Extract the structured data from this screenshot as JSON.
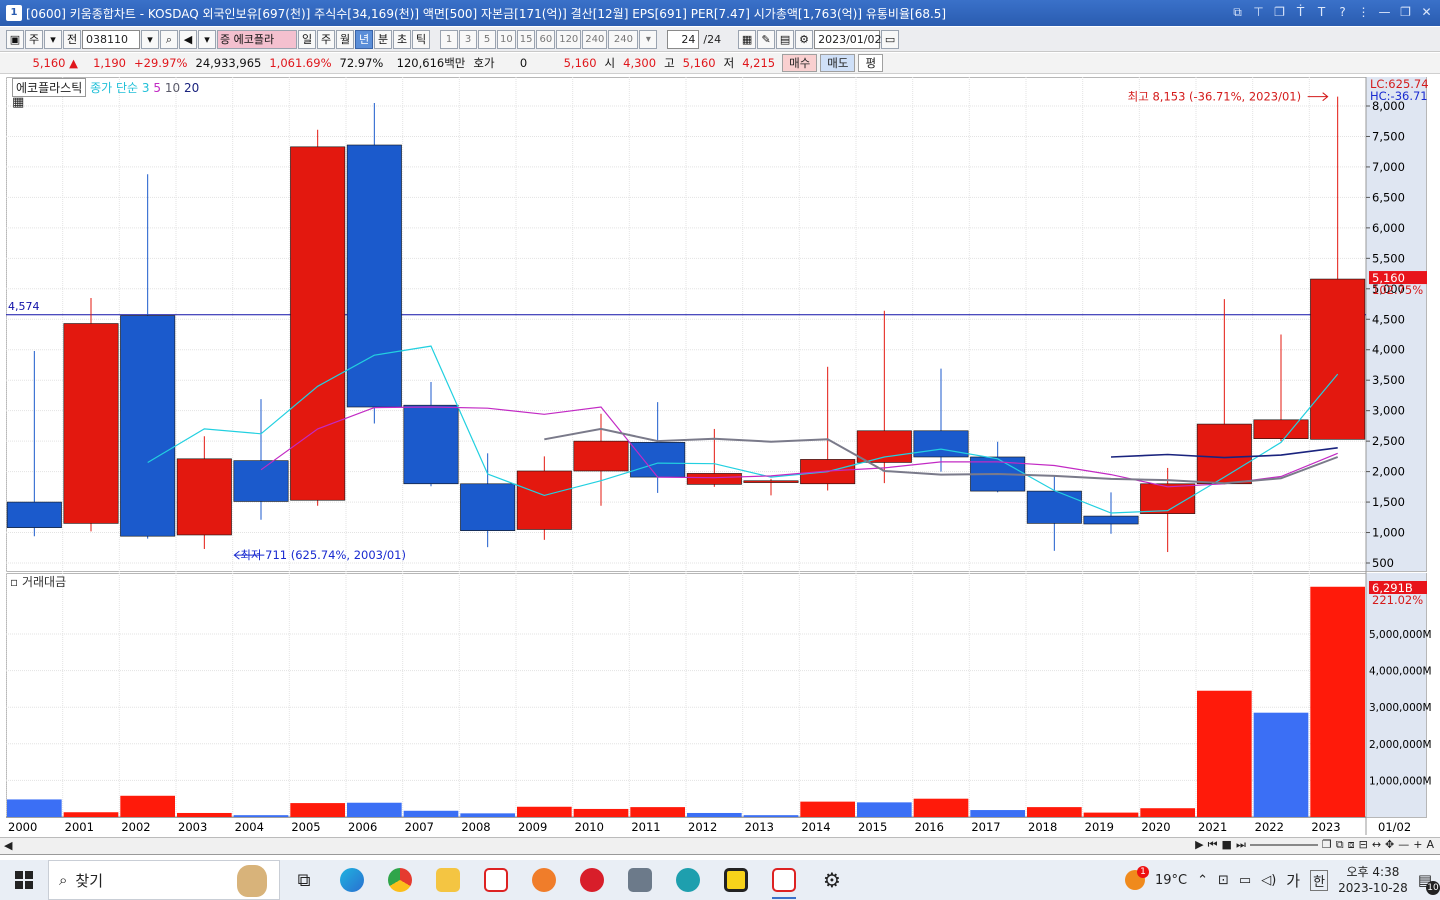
{
  "window": {
    "number": "1",
    "title": "[0600] 키움종합차트 - KOSDAQ 외국인보유[697(천)] 주식수[34,169(천)] 액면[500] 자본금[171(억)] 결산[12월] EPS[691] PER[7.47] 시가총액[1,763(억)] 유통비율[68.5]"
  },
  "toolbar": {
    "mode_a": "주",
    "mode_b": "전",
    "code": "038110",
    "stock_name": "에코플라",
    "periods": [
      "일",
      "주",
      "월",
      "년",
      "분",
      "초",
      "틱"
    ],
    "selected_period": "년",
    "intervals": [
      "1",
      "3",
      "5",
      "10",
      "15",
      "60",
      "120",
      "240",
      "240"
    ],
    "count": "24",
    "count_total": "/24",
    "date": "2023/01/02"
  },
  "quote": {
    "price": "5,160",
    "change": "1,190",
    "change_pct": "+29.97%",
    "volume": "24,933,965",
    "volume_pct": "1,061.69%",
    "turnover": "72.97%",
    "amount": "120,616백만",
    "hoga_label": "호가",
    "hoga_value": "0",
    "current": "5,160",
    "open_label": "시",
    "open": "4,300",
    "high_label": "고",
    "high": "5,160",
    "low_label": "저",
    "low": "4,215",
    "buy": "매수",
    "sell": "매도",
    "even": "평"
  },
  "legend": {
    "name": "에코플라스틱",
    "ma_label": "종가 단순",
    "ma3": "3",
    "ma5": "5",
    "ma10": "10",
    "ma20": "20",
    "volume_panel": "거래대금"
  },
  "annotations": {
    "high": "최고 8,153 (-36.71%, 2023/01)",
    "low": "최저 711 (625.74%, 2003/01)",
    "hline": "4,574",
    "lc": "LC:625.74",
    "hc": "HC:-36.71",
    "price_tag": "5,160",
    "price_tag_pct": "102.75%",
    "vol_tag": "6,291B",
    "vol_tag_pct": "221.02%",
    "last_date": "01/02"
  },
  "colors": {
    "up": "#e3180f",
    "down": "#1b5acc",
    "ma3": "#22d0e0",
    "ma5": "#c22ac4",
    "ma10": "#7a7a8a",
    "ma20": "#1a237e",
    "hline": "#1010a8"
  },
  "chart_data": {
    "type": "candlestick",
    "x": [
      "2000",
      "2001",
      "2002",
      "2003",
      "2004",
      "2005",
      "2006",
      "2007",
      "2008",
      "2009",
      "2010",
      "2011",
      "2012",
      "2013",
      "2014",
      "2015",
      "2016",
      "2017",
      "2018",
      "2019",
      "2020",
      "2021",
      "2022",
      "2023"
    ],
    "ohlc": [
      [
        1500,
        3980,
        940,
        1080
      ],
      [
        1150,
        4850,
        1020,
        4430
      ],
      [
        4560,
        6880,
        900,
        940
      ],
      [
        960,
        2580,
        730,
        2210
      ],
      [
        2180,
        3190,
        1210,
        1510
      ],
      [
        1530,
        7610,
        1440,
        7330
      ],
      [
        7360,
        8050,
        2790,
        3060
      ],
      [
        3090,
        3470,
        1760,
        1800
      ],
      [
        1800,
        2300,
        760,
        1030
      ],
      [
        1050,
        2250,
        880,
        2010
      ],
      [
        2010,
        2950,
        1440,
        2500
      ],
      [
        2480,
        3140,
        1650,
        1910
      ],
      [
        1790,
        2700,
        1750,
        1970
      ],
      [
        1820,
        1880,
        1610,
        1850
      ],
      [
        1800,
        3720,
        1690,
        2200
      ],
      [
        2150,
        4640,
        1810,
        2670
      ],
      [
        2670,
        3690,
        2000,
        2240
      ],
      [
        2240,
        2490,
        1660,
        1680
      ],
      [
        1680,
        1920,
        700,
        1150
      ],
      [
        1270,
        1660,
        980,
        1140
      ],
      [
        1310,
        2060,
        680,
        1800
      ],
      [
        1800,
        4830,
        1790,
        2780
      ],
      [
        2540,
        4250,
        2500,
        2850
      ],
      [
        2530,
        8153,
        4215,
        5160
      ]
    ],
    "ma3": [
      null,
      null,
      2150,
      2700,
      2620,
      3400,
      3910,
      4060,
      1960,
      1610,
      1850,
      2140,
      2130,
      1910,
      2000,
      2240,
      2370,
      2210,
      1690,
      1320,
      1360,
      1910,
      2480,
      3600
    ],
    "ma5": [
      null,
      null,
      null,
      null,
      2030,
      2700,
      3050,
      3060,
      3040,
      2940,
      3060,
      1910,
      1900,
      1930,
      2010,
      2060,
      2160,
      2160,
      2100,
      1950,
      1750,
      1800,
      1920,
      2300
    ],
    "ma10": [
      null,
      null,
      null,
      null,
      null,
      null,
      null,
      null,
      null,
      2530,
      2700,
      2500,
      2540,
      2490,
      2530,
      2010,
      1950,
      1960,
      1930,
      1880,
      1860,
      1810,
      1890,
      2240
    ],
    "ma20": [
      null,
      null,
      null,
      null,
      null,
      null,
      null,
      null,
      null,
      null,
      null,
      null,
      null,
      null,
      null,
      null,
      null,
      null,
      null,
      2240,
      2280,
      2230,
      2270,
      2390
    ],
    "volume": [
      480,
      130,
      580,
      110,
      50,
      380,
      390,
      170,
      100,
      280,
      220,
      270,
      110,
      50,
      420,
      400,
      500,
      190,
      270,
      120,
      240,
      3450,
      2850,
      6291
    ],
    "volume_up": [
      false,
      true,
      true,
      true,
      false,
      true,
      false,
      false,
      false,
      true,
      true,
      true,
      false,
      false,
      true,
      false,
      true,
      false,
      true,
      true,
      true,
      true,
      false,
      true
    ],
    "y_ticks": [
      "500",
      "1,000",
      "1,500",
      "2,000",
      "2,500",
      "3,000",
      "3,500",
      "4,000",
      "4,500",
      "5,000",
      "5,500",
      "6,000",
      "6,500",
      "7,000",
      "7,500",
      "8,000"
    ],
    "vol_ticks": [
      "1,000,000M",
      "2,000,000M",
      "3,000,000M",
      "4,000,000M",
      "5,000,000M"
    ],
    "ylim": [
      500,
      8153
    ],
    "hline": 4574
  },
  "taskbar": {
    "search_placeholder": "찾기",
    "weather": "19°C",
    "weather_badge": "1",
    "ime": "가",
    "ime2": "한",
    "time": "오후 4:38",
    "date": "2023-10-28",
    "notif_count": "10"
  }
}
